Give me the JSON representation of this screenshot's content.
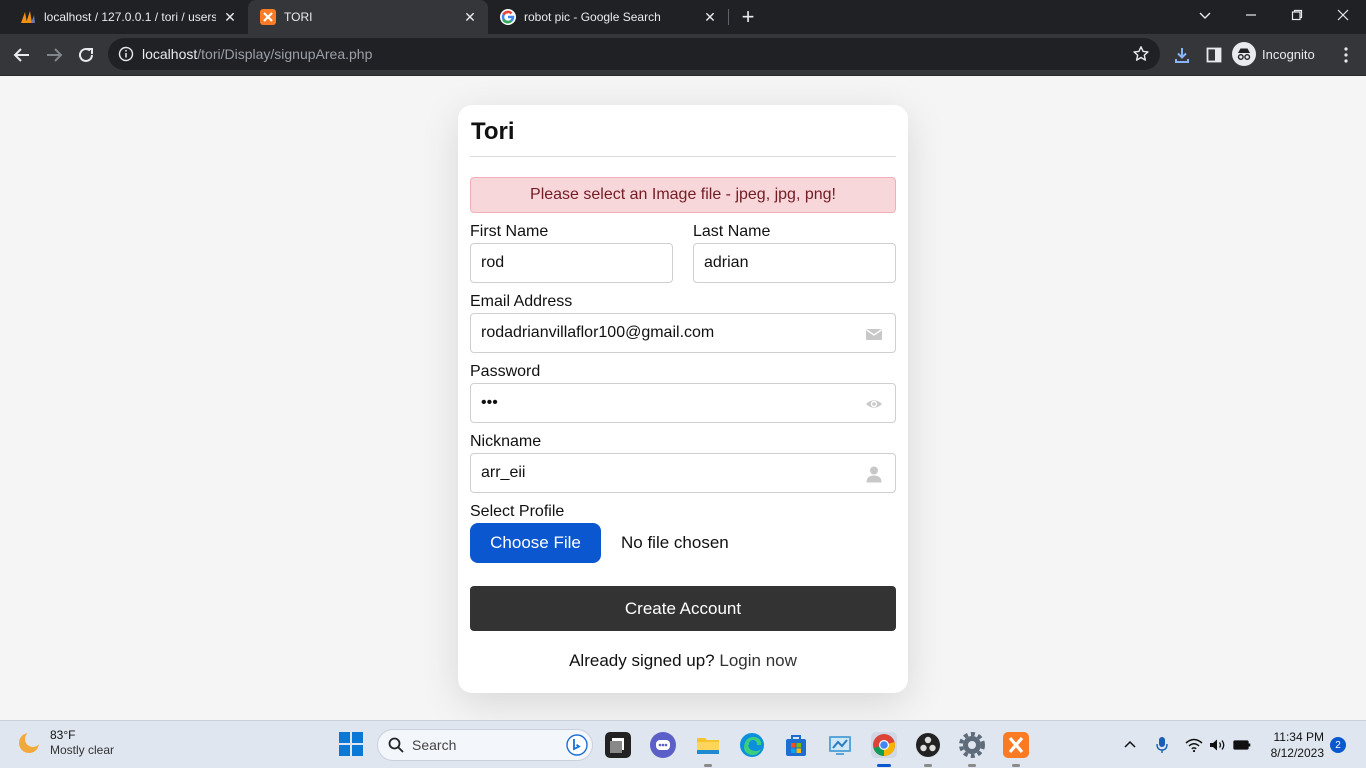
{
  "browser": {
    "tabs": [
      {
        "title": "localhost / 127.0.0.1 / tori / users",
        "favicon": "phpmyadmin-icon",
        "active": false
      },
      {
        "title": "TORI",
        "favicon": "xampp-icon",
        "active": true
      },
      {
        "title": "robot pic - Google Search",
        "favicon": "google-icon",
        "active": false
      }
    ],
    "url_host": "localhost",
    "url_path": "/tori/Display/signupArea.php",
    "profile_label": "Incognito"
  },
  "form": {
    "brand": "Tori",
    "alert": "Please select an Image file - jpeg, jpg, png!",
    "first_name": {
      "label": "First Name",
      "value": "rod"
    },
    "last_name": {
      "label": "Last Name",
      "value": "adrian"
    },
    "email": {
      "label": "Email Address",
      "value": "rodadrianvillaflor100@gmail.com",
      "icon": "envelope-icon"
    },
    "password": {
      "label": "Password",
      "value": "•••",
      "icon": "eye-icon"
    },
    "nickname": {
      "label": "Nickname",
      "value": "arr_eii",
      "icon": "user-icon"
    },
    "profile": {
      "label": "Select Profile",
      "button": "Choose File",
      "status": "No file chosen"
    },
    "submit": "Create Account",
    "footer_text": "Already signed up?",
    "footer_link": "Login now"
  },
  "taskbar": {
    "weather_temp": "83°F",
    "weather_cond": "Mostly clear",
    "search_placeholder": "Search",
    "time": "11:34 PM",
    "date": "8/12/2023",
    "notifications": "2"
  },
  "colors": {
    "alert_bg": "#f8d7da",
    "choose_button": "#0b57d0",
    "create_button": "#333333"
  }
}
